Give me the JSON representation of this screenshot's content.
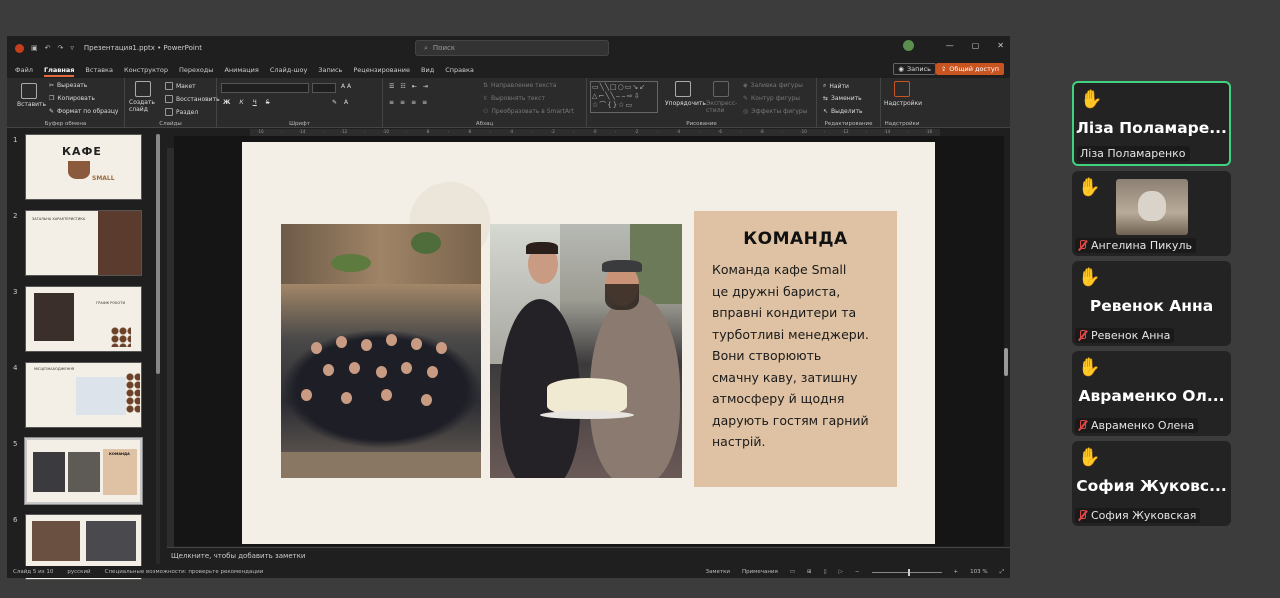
{
  "titlebar": {
    "filename": "Презентация1.pptx  •  PowerPoint",
    "search_placeholder": "Поиск",
    "controls": [
      "—",
      "▢",
      "✕"
    ]
  },
  "tabs": [
    "Файл",
    "Главная",
    "Вставка",
    "Конструктор",
    "Переходы",
    "Анимация",
    "Слайд-шоу",
    "Запись",
    "Рецензирование",
    "Вид",
    "Справка"
  ],
  "tabs_active_index": 1,
  "record_btn": "Запись",
  "share_btn": "Общий доступ",
  "ribbon": {
    "clipboard": {
      "paste": "Вставить",
      "cut": "Вырезать",
      "copy": "Копировать",
      "format_painter": "Формат по образцу",
      "label": "Буфер обмена"
    },
    "slides": {
      "new_slide": "Создать слайд",
      "layout": "Макет",
      "reset": "Восстановить",
      "section": "Раздел",
      "label": "Слайды"
    },
    "font": {
      "bold": "Ж",
      "italic": "К",
      "underline": "Ч",
      "strike": "S",
      "label": "Шрифт"
    },
    "paragraph": {
      "text_direction": "Направление текста",
      "align_text": "Выровнять текст",
      "smartart": "Преобразовать в SmartArt",
      "label": "Абзац"
    },
    "drawing": {
      "arrange": "Упорядочить",
      "quick_styles": "Экспресс-стили",
      "fill": "Заливка фигуры",
      "outline": "Контур фигуры",
      "effects": "Эффекты фигуры",
      "label": "Рисование"
    },
    "editing": {
      "find": "Найти",
      "replace": "Заменить",
      "select": "Выделить",
      "label": "Редактирование"
    },
    "addins": {
      "addins": "Надстройки",
      "label": "Надстройки"
    }
  },
  "thumbnails": [
    {
      "num": "1",
      "title": "КАФЕ",
      "subtitle": "SMALL"
    },
    {
      "num": "2",
      "title": "ЗАГАЛЬНА ХАРАКТЕРИСТИКА"
    },
    {
      "num": "3",
      "title": "ГРАФІК РОБОТИ"
    },
    {
      "num": "4",
      "title": "МІСЦЕЗНАХОДЖЕННЯ"
    },
    {
      "num": "5",
      "title": "КОМАНДА"
    },
    {
      "num": "6"
    }
  ],
  "selected_thumb_index": 4,
  "slide": {
    "title": "КОМАНДА",
    "body": "Команда кафе Small\nце дружні бариста,\nвправні кондитери та\nтурботливі менеджери.\nВони створюють\nсмачну каву, затишну\nатмосферу й щодня\nдарують гостям гарний\nнастрій."
  },
  "notes_placeholder": "Щелкните, чтобы добавить заметки",
  "status": {
    "slide_pos": "Слайд 5 из 10",
    "language": "русский",
    "accessibility": "Специальные возможности: проверьте рекомендации",
    "notes": "Заметки",
    "comments": "Примечания",
    "zoom": "103 %"
  },
  "participants": [
    {
      "big_name": "Ліза Поламаре...",
      "label": "Ліза Поламаренко",
      "muted": false,
      "active": true,
      "video": false
    },
    {
      "big_name": "",
      "label": "Ангелина Пикуль",
      "muted": true,
      "active": false,
      "video": true
    },
    {
      "big_name": "Ревенок Анна",
      "label": "Ревенок Анна",
      "muted": true,
      "active": false,
      "video": false
    },
    {
      "big_name": "Авраменко Ол...",
      "label": "Авраменко Олена",
      "muted": true,
      "active": false,
      "video": false
    },
    {
      "big_name": "София Жуковс...",
      "label": "София Жуковская",
      "muted": true,
      "active": false,
      "video": false
    }
  ],
  "colors": {
    "accent": "#e56a3d",
    "share": "#c9541f",
    "active_speaker": "#3fd27f",
    "team_box": "#dec2a3",
    "slide_bg": "#f4efe6"
  },
  "icons": {
    "hand": "raised-hand-icon",
    "mic": "mic-off-icon"
  }
}
